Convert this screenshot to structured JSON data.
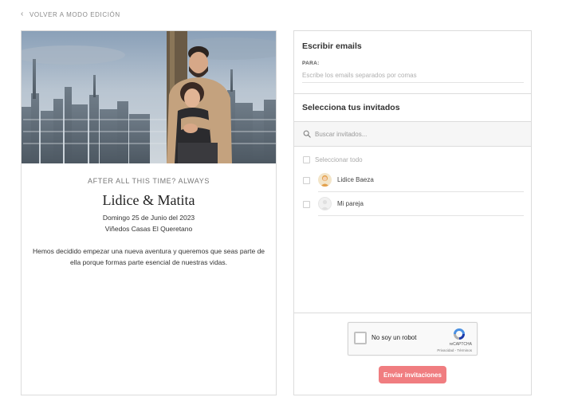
{
  "nav": {
    "back_label": "VOLVER A MODO EDICIÓN"
  },
  "invitation": {
    "tagline": "AFTER ALL THIS TIME? ALWAYS",
    "couple_names": "Lidice & Matita",
    "date": "Domingo 25 de Junio del 2023",
    "venue": "Viñedos Casas El Queretano",
    "message": "Hemos decidido empezar una nueva aventura y queremos que seas parte de ella porque formas parte esencial de nuestras vidas."
  },
  "emails": {
    "title": "Escribir emails",
    "to_label": "PARA:",
    "input_value": "",
    "input_placeholder": "Escribe los emails separados por comas"
  },
  "guests": {
    "title": "Selecciona tus invitados",
    "search_value": "",
    "search_placeholder": "Buscar invitados...",
    "select_all_label": "Seleccionar todo",
    "items": [
      {
        "name": "Lidice Baeza",
        "avatar": "filled"
      },
      {
        "name": "Mi pareja",
        "avatar": "empty"
      }
    ]
  },
  "captcha": {
    "label": "No soy un robot",
    "brand": "reCAPTCHA",
    "links": "Privacidad - Términos"
  },
  "actions": {
    "send_label": "Enviar invitaciones"
  },
  "colors": {
    "accent": "#f07d80",
    "border": "#dcdcdc"
  },
  "icons": [
    "chevron-left-icon",
    "search-icon",
    "avatar-icon",
    "recaptcha-logo-icon"
  ]
}
